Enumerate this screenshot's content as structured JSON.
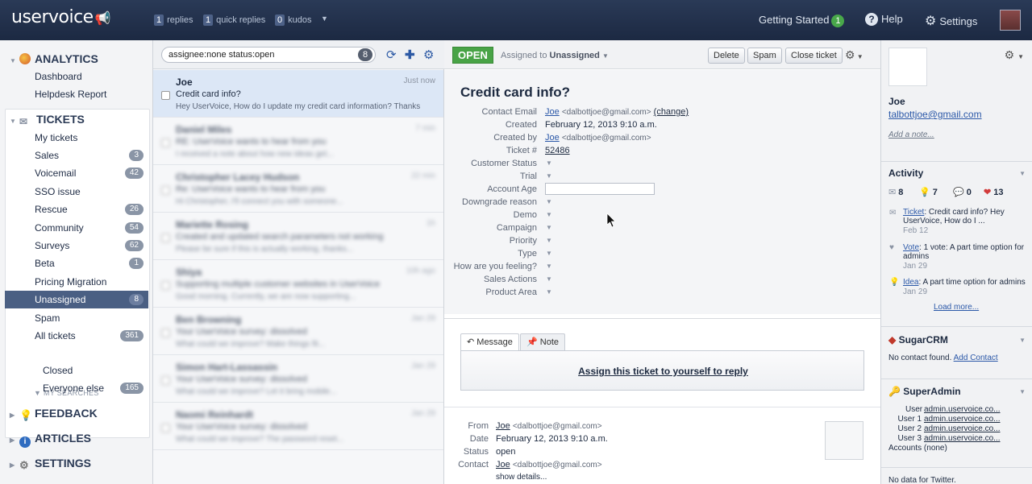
{
  "topbar": {
    "logo": "uservoice",
    "stats": [
      {
        "num": "1",
        "label": "replies"
      },
      {
        "num": "1",
        "label": "quick replies"
      },
      {
        "num": "0",
        "label": "kudos"
      }
    ],
    "getting_started": "Getting Started",
    "getting_started_count": "1",
    "help": "Help",
    "settings": "Settings"
  },
  "nav": {
    "analytics": {
      "title": "ANALYTICS",
      "items": [
        "Dashboard",
        "Helpdesk Report"
      ]
    },
    "tickets": {
      "title": "TICKETS",
      "items": [
        {
          "label": "My tickets",
          "count": ""
        },
        {
          "label": "Sales",
          "count": "3"
        },
        {
          "label": "Voicemail",
          "count": "42"
        },
        {
          "label": "SSO issue",
          "count": ""
        },
        {
          "label": "Rescue",
          "count": "26"
        },
        {
          "label": "Community",
          "count": "54"
        },
        {
          "label": "Surveys",
          "count": "62"
        },
        {
          "label": "Beta",
          "count": "1"
        },
        {
          "label": "Pricing Migration",
          "count": ""
        },
        {
          "label": "Unassigned",
          "count": "8"
        },
        {
          "label": "Spam",
          "count": ""
        },
        {
          "label": "All tickets",
          "count": "361"
        }
      ],
      "my_searches_label": "MY SEARCHES",
      "searches": [
        {
          "label": "Closed",
          "count": ""
        },
        {
          "label": "Everyone else",
          "count": "165"
        }
      ]
    },
    "feedback": "FEEDBACK",
    "articles": "ARTICLES",
    "settings": "SETTINGS"
  },
  "list": {
    "search_value": "assignee:none status:open",
    "search_count": "8",
    "rows": [
      {
        "who": "Joe",
        "when": "Just now",
        "subject": "Credit card info?",
        "preview": "Hey UserVoice, How do I update my credit card information? Thanks"
      },
      {
        "who": "Daniel Miles",
        "when": "7 min",
        "subject": "RE: UserVoice wants to hear from you",
        "preview": "I received a note about how new ideas get..."
      },
      {
        "who": "Christopher Lacey Hudson",
        "when": "22 min",
        "subject": "Re: UserVoice wants to hear from you",
        "preview": "Hi Christopher, I'll connect you with someone..."
      },
      {
        "who": "Mariette Rosing",
        "when": "1h",
        "subject": "Created and updated search parameters not working",
        "preview": "Please be sure if this is actually working, thanks..."
      },
      {
        "who": "Shiya",
        "when": "10h ago",
        "subject": "Supporting multiple customer websites in UserVoice",
        "preview": "Good morning. Currently, we are now supporting..."
      },
      {
        "who": "Ben Browning",
        "when": "Jan 29",
        "subject": "Your UserVoice survey: dissolved",
        "preview": "What could we improve? Make things fit..."
      },
      {
        "who": "Simon Hart-Lassassin",
        "when": "Jan 29",
        "subject": "Your UserVoice survey: dissolved",
        "preview": "What could we improve? Let it bring mobile..."
      },
      {
        "who": "Naomi Reinhardt",
        "when": "Jan 29",
        "subject": "Your UserVoice survey: dissolved",
        "preview": "What could we improve? The password reset..."
      }
    ]
  },
  "ticket": {
    "status": "OPEN",
    "assigned_prefix": "Assigned to",
    "assigned_to": "Unassigned",
    "buttons": [
      "Delete",
      "Spam",
      "Close ticket"
    ],
    "title": "Credit card info?",
    "contact_email_label": "Contact Email",
    "contact_name": "Joe",
    "contact_email": "<dalbottjoe@gmail.com>",
    "change": "(change)",
    "created_label": "Created",
    "created": "February 12, 2013 9:10 a.m.",
    "created_by_label": "Created by",
    "ticket_num_label": "Ticket #",
    "ticket_num": "52486",
    "dropdown_fields": [
      "Customer Status",
      "Trial"
    ],
    "account_age_label": "Account Age",
    "more_fields": [
      "Downgrade reason",
      "Demo",
      "Campaign",
      "Priority",
      "Type",
      "How are you feeling?",
      "Sales Actions",
      "Product Area"
    ]
  },
  "reply": {
    "tab_message": "Message",
    "tab_note": "Note",
    "assign_link": "Assign this ticket to yourself to reply"
  },
  "message": {
    "from_label": "From",
    "from_name": "Joe",
    "from_email": "<dalbottjoe@gmail.com>",
    "date_label": "Date",
    "date": "February 12, 2013 9:10 a.m.",
    "status_label": "Status",
    "status": "open",
    "contact_label": "Contact",
    "contact_name": "Joe",
    "contact_email": "<dalbottjoe@gmail.com>",
    "show_details": "show details..."
  },
  "sidebar": {
    "name": "Joe",
    "email": "talbottjoe@gmail.com",
    "add_note": "Add a note...",
    "activity_title": "Activity",
    "counts": {
      "tickets": "8",
      "ideas": "7",
      "comments": "0",
      "kudos": "13"
    },
    "activities": [
      {
        "type": "Ticket",
        "text": ": Credit card info? Hey UserVoice, How do I ...",
        "date": "Feb 12"
      },
      {
        "type": "Vote",
        "text": ": 1 vote: A part time option for admins",
        "date": "Jan 29"
      },
      {
        "type": "Idea",
        "text": ": A part time option for admins",
        "date": "Jan 29"
      }
    ],
    "load_more": "Load more...",
    "sugarcrm_title": "SugarCRM",
    "no_contact": "No contact found.",
    "add_contact": "Add Contact",
    "superadmin_title": "SuperAdmin",
    "superadmin_rows": [
      {
        "label": "User",
        "value": "admin.uservoice.co..."
      },
      {
        "label": "User 1",
        "value": "admin.uservoice.co..."
      },
      {
        "label": "User 2",
        "value": "admin.uservoice.co..."
      },
      {
        "label": "User 3",
        "value": "admin.uservoice.co..."
      }
    ],
    "accounts_label": "Accounts",
    "accounts_value": "(none)",
    "twitter": "No data for Twitter."
  },
  "colors": {
    "topbar": "#1c2942",
    "open_badge": "#48a346",
    "active_nav": "#4a5f83",
    "link": "#2b58a8"
  }
}
